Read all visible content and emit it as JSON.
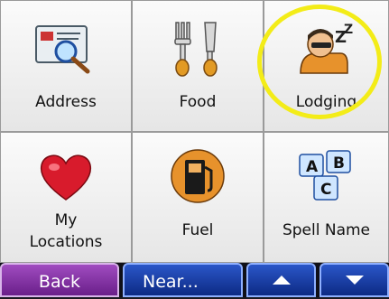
{
  "tiles": [
    {
      "label": "Address",
      "icon": "address-card-magnifier-icon"
    },
    {
      "label": "Food",
      "icon": "fork-knife-icon"
    },
    {
      "label": "Lodging",
      "icon": "sleeping-person-icon"
    },
    {
      "label_line1": "My",
      "label_line2": "Locations",
      "icon": "heart-icon"
    },
    {
      "label": "Fuel",
      "icon": "fuel-pump-icon"
    },
    {
      "label": "Spell Name",
      "icon": "abc-blocks-icon"
    }
  ],
  "bottom_bar": {
    "back_label": "Back",
    "near_label": "Near...",
    "up_icon": "up-arrow-icon",
    "down_icon": "down-arrow-icon"
  },
  "colors": {
    "highlight": "#f3ec18",
    "back_button": "#8a34aa",
    "nav_button": "#1c3fa8"
  }
}
